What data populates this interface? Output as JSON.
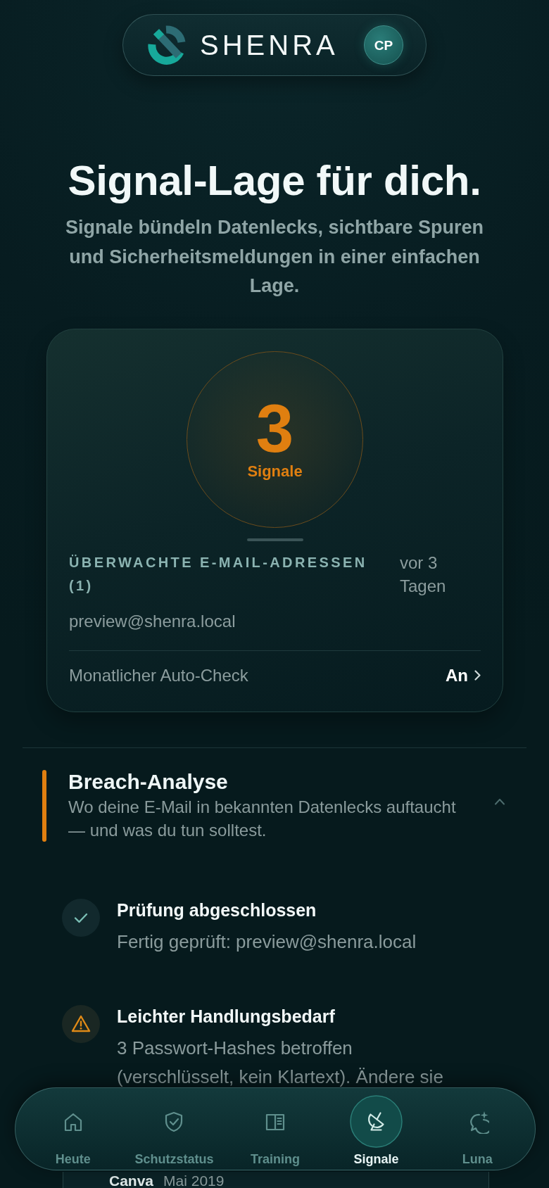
{
  "header": {
    "brand": "SHENRA",
    "avatar_initials": "CP"
  },
  "hero": {
    "title": "Signal-Lage für dich.",
    "subtitle": "Signale bündeln Datenlecks, sichtbare Spuren und Sicherheitsmeldungen in einer einfachen Lage."
  },
  "summary": {
    "count": "3",
    "count_label": "Signale",
    "monitored_label": "ÜBERWACHTE E-MAIL-ADRESSEN (1)",
    "last_check": "vor 3 Tagen",
    "email": "preview@shenra.local",
    "auto_check_label": "Monatlicher Auto-Check",
    "auto_check_value": "An"
  },
  "section": {
    "title": "Breach-Analyse",
    "subtitle": "Wo deine E-Mail in bekannten Datenlecks auftaucht — und was du tun solltest.",
    "expanded": true,
    "findings": [
      {
        "kind": "done",
        "title": "Prüfung abgeschlossen",
        "text": "Fertig geprüft: preview@shenra.local"
      },
      {
        "kind": "warning",
        "title": "Leichter Handlungsbedarf",
        "text": "3 Passwort-Hashes betroffen (verschlüsselt, kein Klartext). Ändere sie"
      }
    ],
    "breaches": [
      {
        "name": "Canva",
        "date": "Mai 2019"
      }
    ]
  },
  "nav": [
    {
      "label": "Heute",
      "selected": false
    },
    {
      "label": "Schutzstatus",
      "selected": false
    },
    {
      "label": "Training",
      "selected": false
    },
    {
      "label": "Signale",
      "selected": true
    },
    {
      "label": "Luna",
      "selected": false
    }
  ]
}
